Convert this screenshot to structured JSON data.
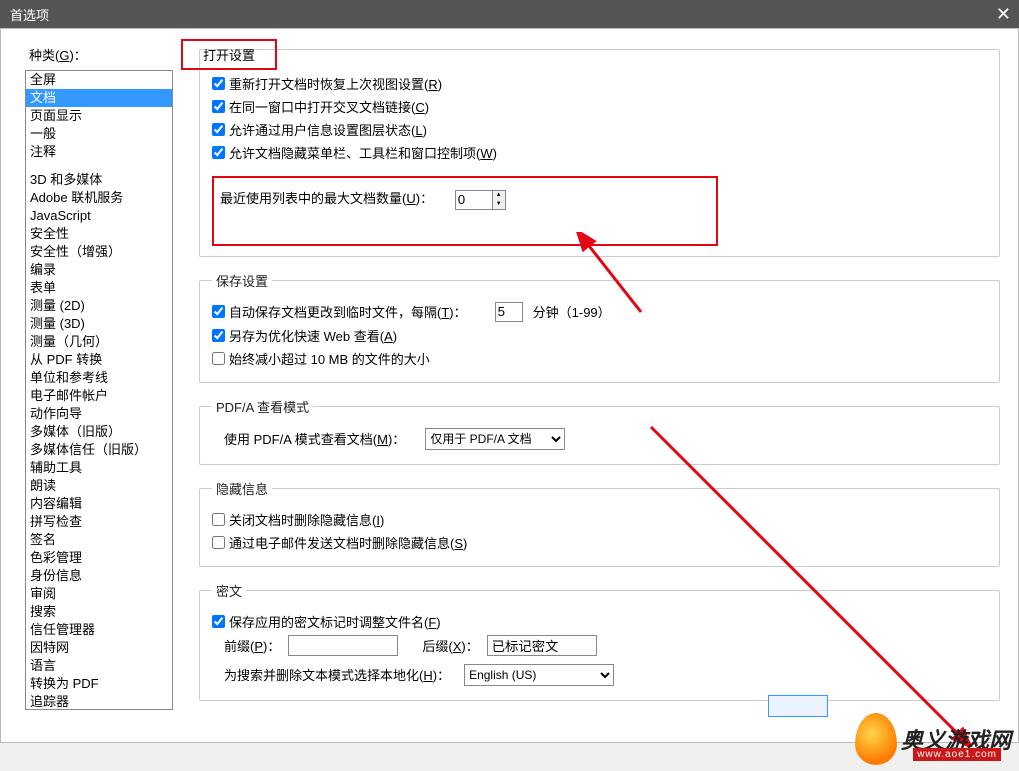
{
  "titlebar": {
    "title": "首选项"
  },
  "left": {
    "category_label_pre": "种类(",
    "category_label_key": "G",
    "category_label_post": ")：",
    "items": [
      "全屏",
      "文档",
      "页面显示",
      "一般",
      "注释",
      "",
      "3D 和多媒体",
      "Adobe 联机服务",
      "JavaScript",
      "安全性",
      "安全性（增强）",
      "编录",
      "表单",
      "测量 (2D)",
      "测量 (3D)",
      "测量（几何）",
      "从 PDF 转换",
      "单位和参考线",
      "电子邮件帐户",
      "动作向导",
      "多媒体（旧版）",
      "多媒体信任（旧版）",
      "辅助工具",
      "朗读",
      "内容编辑",
      "拼写检查",
      "签名",
      "色彩管理",
      "身份信息",
      "审阅",
      "搜索",
      "信任管理器",
      "因特网",
      "语言",
      "转换为 PDF",
      "追踪器"
    ],
    "selected_index": 1
  },
  "open": {
    "legend": "打开设置",
    "chk1": "重新打开文档时恢复上次视图设置(",
    "chk1_key": "R",
    "chk1_post": ")",
    "chk2": "在同一窗口中打开交叉文档链接(",
    "chk2_key": "C",
    "chk2_post": ")",
    "chk3": "允许通过用户信息设置图层状态(",
    "chk3_key": "L",
    "chk3_post": ")",
    "chk4": "允许文档隐藏菜单栏、工具栏和窗口控制项(",
    "chk4_key": "W",
    "chk4_post": ")",
    "recent_label": "最近使用列表中的最大文档数量(",
    "recent_key": "U",
    "recent_post": ")：",
    "recent_value": "0"
  },
  "save": {
    "legend": "保存设置",
    "chk1_pre": "自动保存文档更改到临时文件，每隔(",
    "chk1_key": "T",
    "chk1_post": ")：",
    "interval": "5",
    "minutes_label": "分钟（1-99）",
    "chk2": "另存为优化快速 Web 查看(",
    "chk2_key": "A",
    "chk2_post": ")",
    "chk3": "始终减小超过 10 MB 的文件的大小"
  },
  "pdfa": {
    "legend": "PDF/A 查看模式",
    "label": "使用 PDF/A 模式查看文档(",
    "label_key": "M",
    "label_post": ")：",
    "options": [
      "仅用于 PDF/A 文档"
    ]
  },
  "hidden": {
    "legend": "隐藏信息",
    "chk1": "关闭文档时删除隐藏信息(",
    "chk1_key": "I",
    "chk1_post": ")",
    "chk2": "通过电子邮件发送文档时删除隐藏信息(",
    "chk2_key": "S",
    "chk2_post": ")"
  },
  "redact": {
    "legend": "密文",
    "chk1": "保存应用的密文标记时调整文件名(",
    "chk1_key": "F",
    "chk1_post": ")",
    "prefix_label": "前缀(",
    "prefix_key": "P",
    "prefix_post": ")：",
    "prefix_value": "",
    "suffix_label": "后缀(",
    "suffix_key": "X",
    "suffix_post": ")：",
    "suffix_value": "已标记密文",
    "locale_label": "为搜索并删除文本模式选择本地化(",
    "locale_key": "H",
    "locale_post": ")：",
    "locale_options": [
      "English (US)"
    ]
  },
  "watermark": {
    "brand": "奥义游戏网",
    "url": "www.aoe1.com"
  }
}
